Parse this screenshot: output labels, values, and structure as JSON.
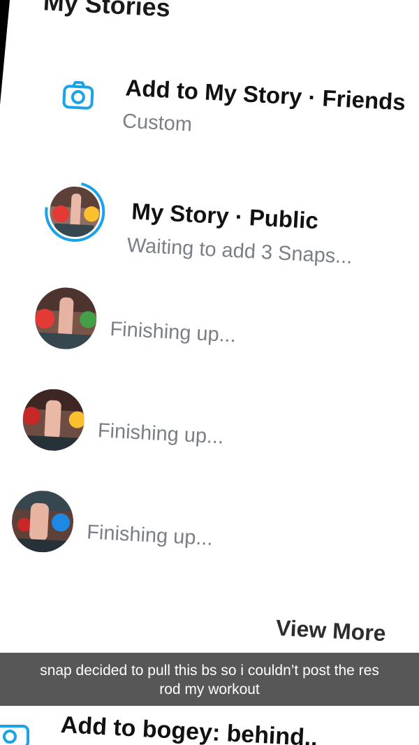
{
  "section": {
    "title": "My Stories"
  },
  "add_story": {
    "title": "Add to My Story · Friends",
    "subtitle": "Custom",
    "icon": "camera-icon"
  },
  "my_story_public": {
    "title": "My Story · Public",
    "subtitle": "Waiting to add 3 Snaps...",
    "ring_color": "#29b6f6"
  },
  "pending": [
    {
      "status": "Finishing up..."
    },
    {
      "status": "Finishing up..."
    },
    {
      "status": "Finishing up..."
    }
  ],
  "view_more": "View More",
  "caption": {
    "line1": "snap decided to pull this bs so i couldn’t post the res",
    "line2": "rod my workout"
  },
  "bottom_row": {
    "title": "Add to bogey: behind..",
    "icon": "camera-icon"
  },
  "colors": {
    "accent": "#1aa3e8",
    "title": "#111111",
    "subtitle": "#7a7f87",
    "caption_bg": "#282828"
  }
}
